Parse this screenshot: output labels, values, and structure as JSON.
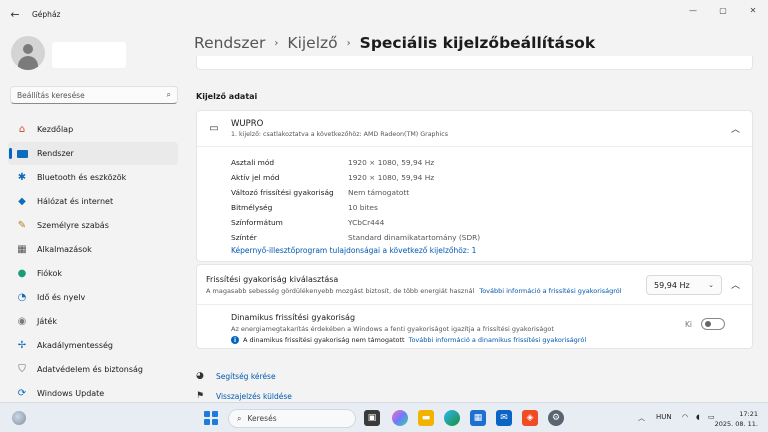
{
  "window": {
    "title": "Gépház",
    "controls": {
      "minimize": "—",
      "maximize": "▢",
      "close": "✕"
    }
  },
  "search": {
    "placeholder": "Beállítás keresése"
  },
  "sidebar": {
    "items": [
      {
        "label": "Kezdőlap",
        "icon": "home-icon",
        "color": "#d04a2a"
      },
      {
        "label": "Rendszer",
        "icon": "system-icon",
        "color": "#0f6cbd",
        "active": true
      },
      {
        "label": "Bluetooth és eszközök",
        "icon": "bluetooth-icon",
        "color": "#0f6cbd"
      },
      {
        "label": "Hálózat és internet",
        "icon": "network-icon",
        "color": "#0f6cbd"
      },
      {
        "label": "Személyre szabás",
        "icon": "brush-icon",
        "color": "#c07a1a"
      },
      {
        "label": "Alkalmazások",
        "icon": "apps-icon",
        "color": "#555555"
      },
      {
        "label": "Fiókok",
        "icon": "account-icon",
        "color": "#1a9c7a"
      },
      {
        "label": "Idő és nyelv",
        "icon": "globe-clock-icon",
        "color": "#0f6cbd"
      },
      {
        "label": "Játék",
        "icon": "gamepad-icon",
        "color": "#7a7a7a"
      },
      {
        "label": "Akadálymentesség",
        "icon": "accessibility-icon",
        "color": "#0f6cbd"
      },
      {
        "label": "Adatvédelem és biztonság",
        "icon": "shield-icon",
        "color": "#6a6a6a"
      },
      {
        "label": "Windows Update",
        "icon": "update-icon",
        "color": "#0f6cbd"
      }
    ]
  },
  "breadcrumb": {
    "items": [
      "Rendszer",
      "Kijelző"
    ],
    "current": "Speciális kijelzőbeállítások"
  },
  "display_info": {
    "section_title": "Kijelző adatai",
    "name": "WUPRO",
    "subtitle": "1. kijelző: csatlakoztatva a következőhöz: AMD Radeon(TM) Graphics",
    "properties": [
      {
        "key": "Asztali mód",
        "value": "1920 × 1080, 59,94 Hz"
      },
      {
        "key": "Aktív jel mód",
        "value": "1920 × 1080, 59,94 Hz"
      },
      {
        "key": "Változó frissítési gyakoriság",
        "value": "Nem támogatott"
      },
      {
        "key": "Bitmélység",
        "value": "10 bites"
      },
      {
        "key": "Színformátum",
        "value": "YCbCr444"
      },
      {
        "key": "Színtér",
        "value": "Standard dinamikatartomány (SDR)"
      }
    ],
    "adapter_link": "Képernyő-illesztőprogram tulajdonságai a következő kijelzőhöz: 1"
  },
  "refresh": {
    "title": "Frissítési gyakoriság kiválasztása",
    "description": "A magasabb sebesség gördülékenyebb mozgást biztosít, de több energiát használ",
    "more_link": "További információ a frissítési gyakoriságról",
    "selected": "59,94 Hz",
    "dynamic_title": "Dinamikus frissítési gyakoriság",
    "dynamic_desc": "Az energiamegtakarítás érdekében a Windows a fenti gyakoriságot igazítja a frissítési gyakoriságot",
    "dynamic_note": "A dinamikus frissítési gyakoriság nem támogatott",
    "dynamic_note_link": "További információ a dinamikus frissítési gyakoriságról",
    "toggle_label": "Ki",
    "toggle_on": false
  },
  "help": {
    "get_help": "Segítség kérése",
    "feedback": "Visszajelzés küldése"
  },
  "taskbar": {
    "search": "Keresés",
    "language": "HUN",
    "time": "17:21",
    "date": "2025. 08. 11."
  }
}
